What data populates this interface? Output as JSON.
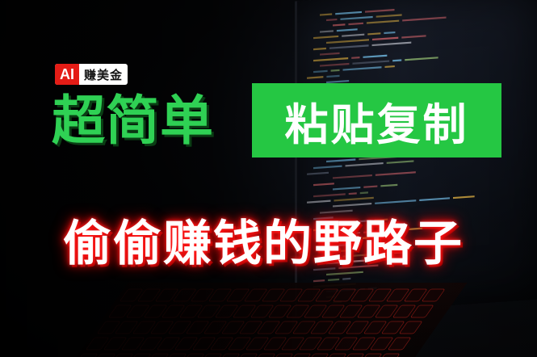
{
  "badge": {
    "ai": "AI",
    "text": "赚美金"
  },
  "headline": {
    "simple": "超简单",
    "paste": "粘贴复制"
  },
  "slogan": "偷偷赚钱的野路子",
  "colors": {
    "green_text": "#2fd154",
    "green_box": "#25c743",
    "badge_red": "#e41c16",
    "glow_red": "#ff1010",
    "background": "#050505"
  },
  "icons": [
    "laptop-code-screen-illustration",
    "keyboard-illustration"
  ]
}
